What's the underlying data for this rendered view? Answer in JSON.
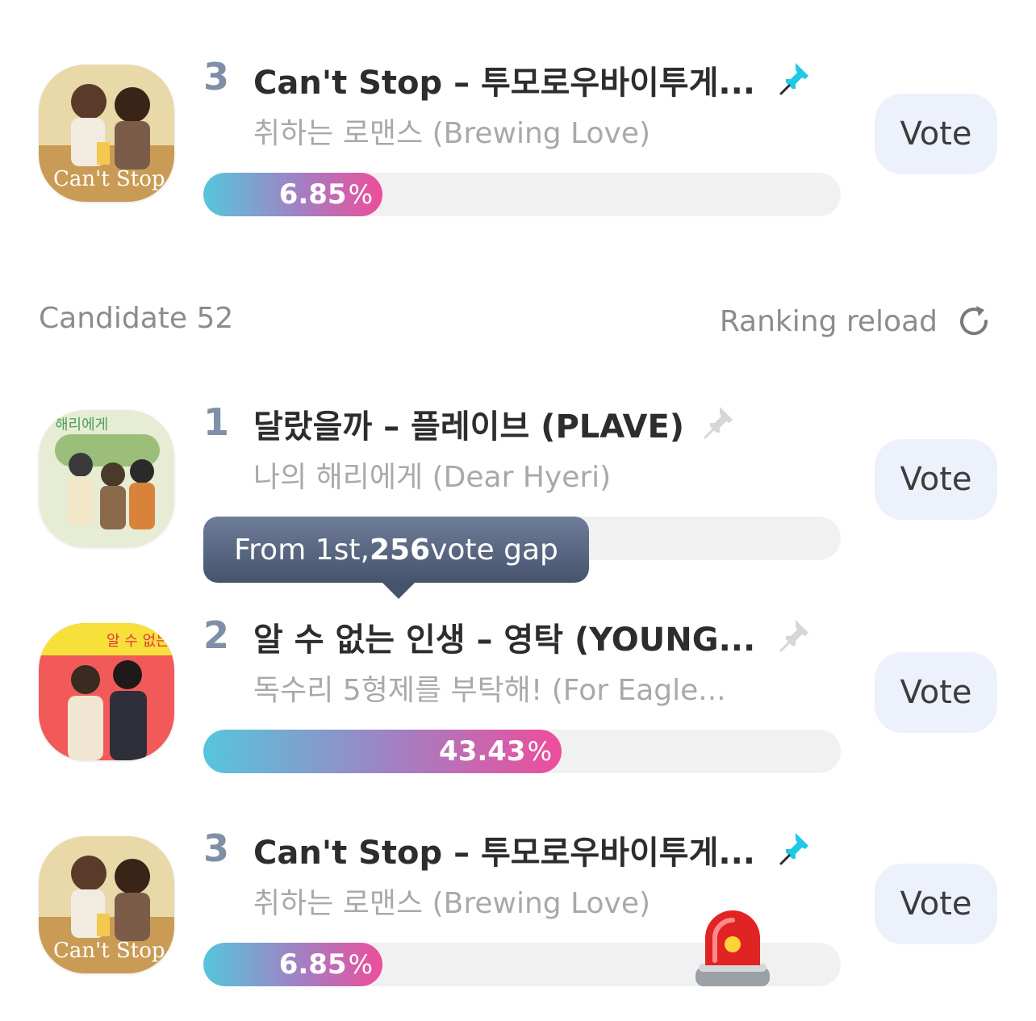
{
  "top_item": {
    "rank": "3",
    "title": "Can't Stop – 투모로우바이투게...",
    "subtitle": "취하는 로맨스 (Brewing Love)",
    "percent": "6.85",
    "percent_symbol": "%",
    "fill_fraction": 0.0685,
    "pinned": true,
    "vote_label": "Vote",
    "thumb_text": "Can't Stop"
  },
  "header": {
    "candidate_label": "Candidate 52",
    "reload_label": "Ranking reload",
    "reload_icon": "reload-icon"
  },
  "items": [
    {
      "rank": "1",
      "title": "달랐을까 – 플레이브 (PLAVE)",
      "subtitle": "나의 해리에게 (Dear Hyeri)",
      "pinned": false,
      "vote_label": "Vote",
      "thumb_text": "해리에게"
    },
    {
      "rank": "2",
      "title": "알 수 없는 인생 – 영탁 (YOUNG...",
      "subtitle": "독수리 5형제를 부탁해! (For Eagle...",
      "percent": "43.43",
      "percent_symbol": "%",
      "fill_fraction": 0.4343,
      "pinned": false,
      "vote_label": "Vote",
      "thumb_text": "알 수 없는"
    },
    {
      "rank": "3",
      "title": "Can't Stop – 투모로우바이투게...",
      "subtitle": "취하는 로맨스 (Brewing Love)",
      "percent": "6.85",
      "percent_symbol": "%",
      "fill_fraction": 0.0685,
      "pinned": true,
      "vote_label": "Vote",
      "thumb_text": "Can't Stop"
    }
  ],
  "tooltip": {
    "prefix": "From 1st, ",
    "gap_number": "256",
    "suffix": " vote gap"
  },
  "colors": {
    "pin_active": "#1ec8e6",
    "pin_inactive": "#d6d6d6",
    "vote_bg": "#edf1fb",
    "gradient_start": "#55c6dc",
    "gradient_end": "#ee4d9b"
  },
  "icons": [
    "pin-icon",
    "reload-icon",
    "siren-icon"
  ]
}
